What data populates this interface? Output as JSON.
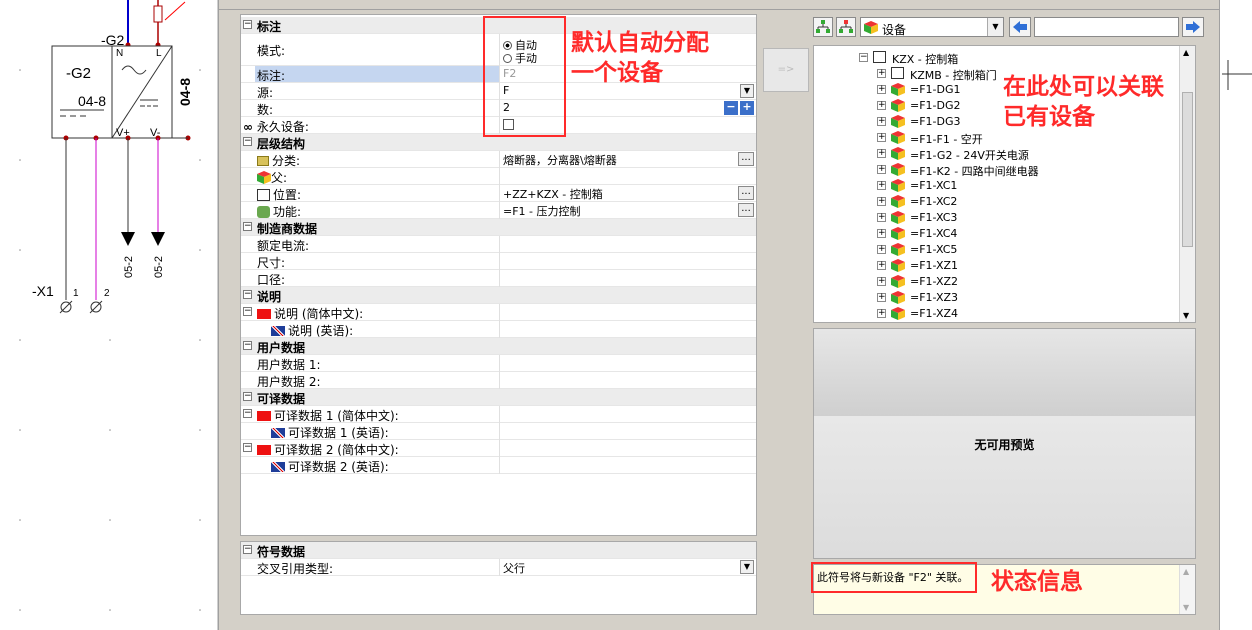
{
  "schematic": {
    "device_top": "-G2",
    "device_inner": "-G2",
    "device_code_inner": "04-8",
    "device_code_side": "04-8",
    "pin_n": "N",
    "pin_l": "L",
    "pin_vplus": "V+",
    "pin_vminus": "V-",
    "arrow_label_1": "05-2",
    "arrow_label_2": "05-2",
    "terminal": "-X1",
    "terminal_pin_1": "1",
    "terminal_pin_2": "2"
  },
  "properties": {
    "sections": {
      "tag": "标注",
      "hierarchy": "层级结构",
      "manufacturer": "制造商数据",
      "description": "说明",
      "user_data": "用户数据",
      "translatable": "可译数据"
    },
    "mode_label": "模式:",
    "mode_auto": "自动",
    "mode_manual": "手动",
    "tag_label": "标注:",
    "tag_value": "F2",
    "source_label": "源:",
    "source_value": "F",
    "count_label": "数:",
    "count_value": "2",
    "permanent_label": "永久设备:",
    "class_label": "分类:",
    "class_value": "熔断器，分离器\\熔断器",
    "parent_label": "父:",
    "location_label": "位置:",
    "location_value": "+ZZ+KZX - 控制箱",
    "function_label": "功能:",
    "function_value": "=F1 - 压力控制",
    "rated_current_label": "额定电流:",
    "size_label": "尺寸:",
    "caliber_label": "口径:",
    "desc_cn_label": "说明 (简体中文):",
    "desc_en_label": "说明 (英语):",
    "user_data1_label": "用户数据 1:",
    "user_data2_label": "用户数据 2:",
    "trans1_cn_label": "可译数据 1 (简体中文):",
    "trans1_en_label": "可译数据 1 (英语):",
    "trans2_cn_label": "可译数据 2 (简体中文):",
    "trans2_en_label": "可译数据 2 (英语):"
  },
  "symbol": {
    "section": "符号数据",
    "xref_label": "交叉引用类型:",
    "xref_value": "父行"
  },
  "transfer_button": "=>",
  "device_browser": {
    "filter_value": "设备",
    "search_value": "",
    "items": [
      {
        "label": "KZX - 控制箱",
        "type": "cabinet",
        "level": 0
      },
      {
        "label": "KZMB - 控制箱门",
        "type": "cabinet",
        "level": 1
      },
      {
        "label": "=F1-DG1",
        "type": "device",
        "level": 1
      },
      {
        "label": "=F1-DG2",
        "type": "device",
        "level": 1
      },
      {
        "label": "=F1-DG3",
        "type": "device",
        "level": 1
      },
      {
        "label": "=F1-F1 - 空开",
        "type": "device",
        "level": 1
      },
      {
        "label": "=F1-G2 - 24V开关电源",
        "type": "device",
        "level": 1
      },
      {
        "label": "=F1-K2 - 四路中间继电器",
        "type": "device",
        "level": 1
      },
      {
        "label": "=F1-XC1",
        "type": "device",
        "level": 1
      },
      {
        "label": "=F1-XC2",
        "type": "device",
        "level": 1
      },
      {
        "label": "=F1-XC3",
        "type": "device",
        "level": 1
      },
      {
        "label": "=F1-XC4",
        "type": "device",
        "level": 1
      },
      {
        "label": "=F1-XC5",
        "type": "device",
        "level": 1
      },
      {
        "label": "=F1-XZ1",
        "type": "device",
        "level": 1
      },
      {
        "label": "=F1-XZ2",
        "type": "device",
        "level": 1
      },
      {
        "label": "=F1-XZ3",
        "type": "device",
        "level": 1
      },
      {
        "label": "=F1-XZ4",
        "type": "device",
        "level": 1
      }
    ]
  },
  "preview_text": "无可用预览",
  "status_text": "此符号将与新设备 \"F2\" 关联。",
  "annotations": {
    "default_auto": [
      "默认自动分配",
      "一个设备"
    ],
    "associate": [
      "在此处可以关联",
      "已有设备"
    ],
    "status": "状态信息"
  },
  "colors": {
    "annotation": "#ff2a2a",
    "selected_row": "#c5d6f0",
    "wire_magenta": "#cc00cc",
    "wire_blue": "#0000cc"
  }
}
